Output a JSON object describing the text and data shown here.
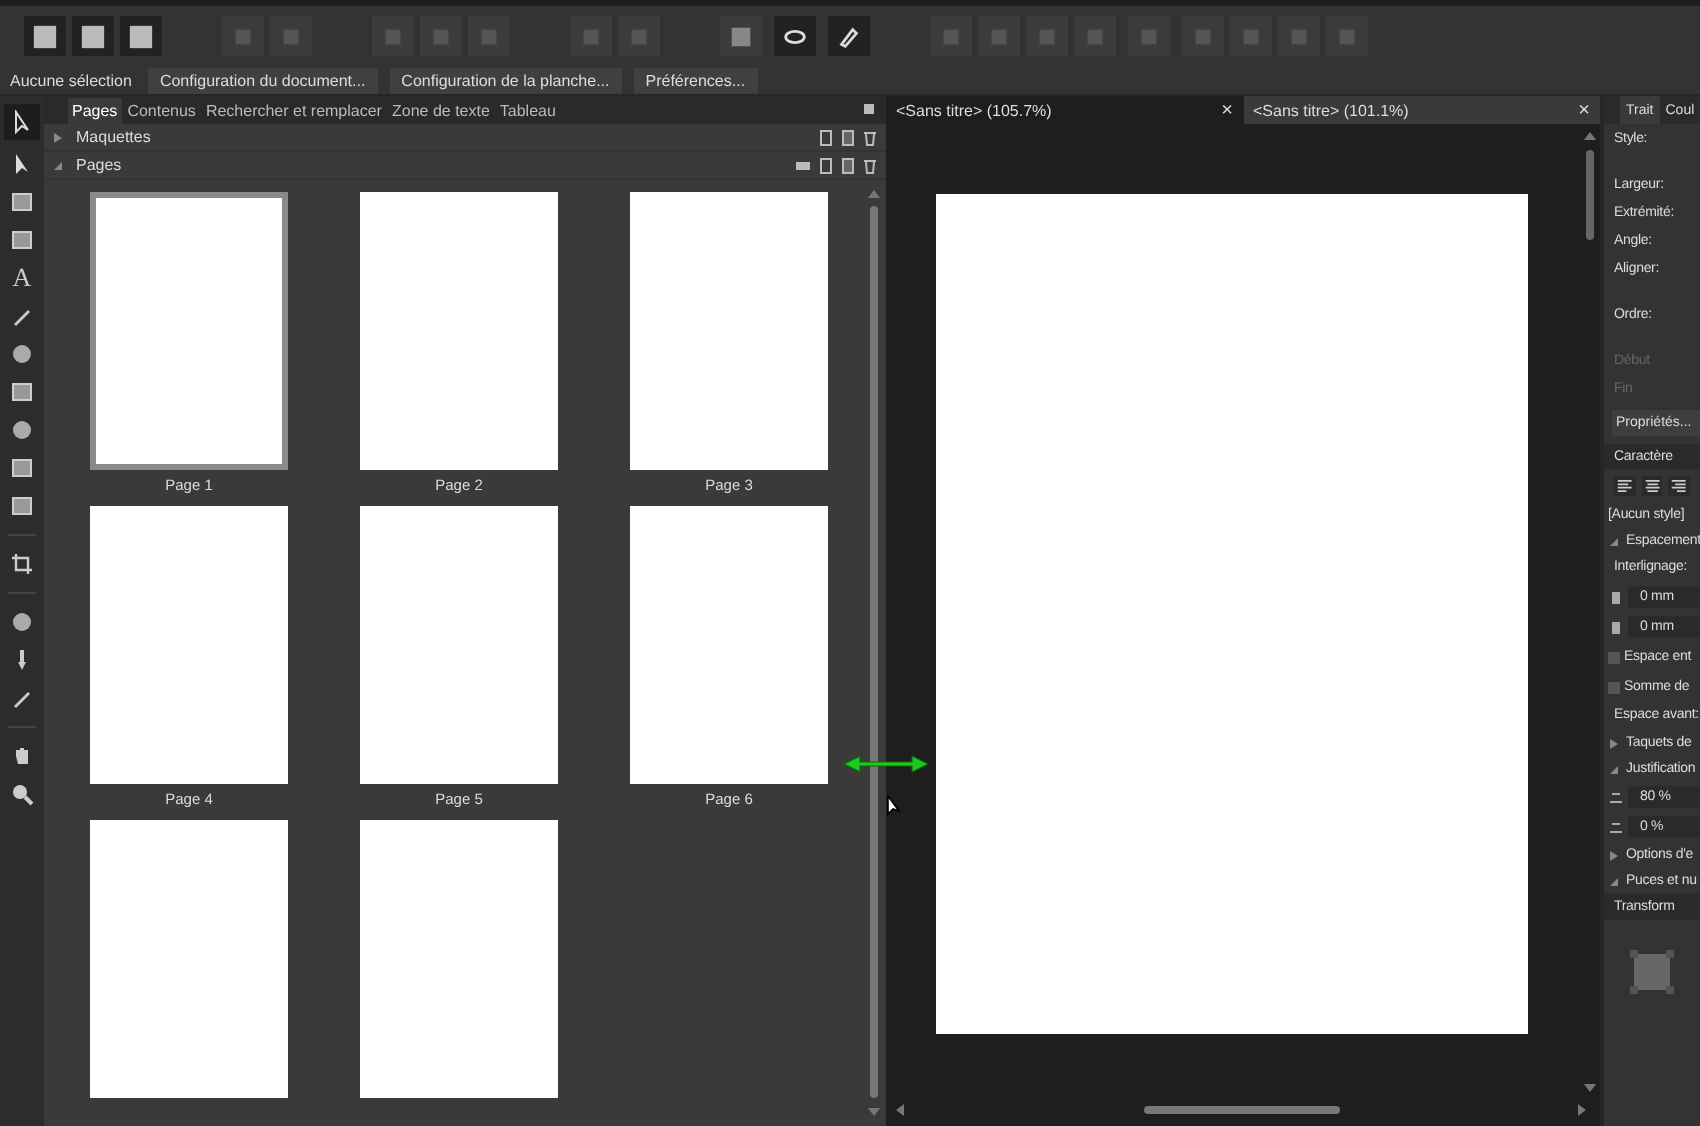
{
  "context_bar": {
    "status": "Aucune sélection",
    "buttons": [
      "Configuration du document...",
      "Configuration de la planche...",
      "Préférences..."
    ]
  },
  "text_tool_glyph": "A",
  "studio_tabs": [
    {
      "label": "Pages",
      "selected": true
    },
    {
      "label": "Contenus",
      "selected": false
    },
    {
      "label": "Rechercher et remplacer",
      "selected": false
    },
    {
      "label": "Zone de texte",
      "selected": false
    },
    {
      "label": "Tableau",
      "selected": false
    }
  ],
  "sections": [
    {
      "label": "Maquettes",
      "expanded": false
    },
    {
      "label": "Pages",
      "expanded": true
    }
  ],
  "pages": [
    {
      "label": "Page 1",
      "selected": true
    },
    {
      "label": "Page 2",
      "selected": false
    },
    {
      "label": "Page 3",
      "selected": false
    },
    {
      "label": "Page 4",
      "selected": false
    },
    {
      "label": "Page 5",
      "selected": false
    },
    {
      "label": "Page 6",
      "selected": false
    },
    {
      "selected": false
    },
    {
      "selected": false
    }
  ],
  "document_tabs": [
    {
      "title": "<Sans titre> (105.7%)",
      "selected": true
    },
    {
      "title": "<Sans titre> (101.1%)",
      "selected": false
    }
  ],
  "close_glyph": "×",
  "right_panel": {
    "tabs": [
      {
        "label": "Trait",
        "selected": true
      },
      {
        "label": "Coul",
        "selected": false
      }
    ],
    "stroke_rows": [
      {
        "label": "Style:",
        "disabled": false
      },
      {
        "label": "Largeur:",
        "disabled": false
      },
      {
        "label": "Extrémité:",
        "disabled": false
      },
      {
        "label": "Angle:",
        "disabled": false
      },
      {
        "label": "Aligner:",
        "disabled": false
      },
      {
        "label": "Ordre:",
        "disabled": false
      },
      {
        "label": "Début",
        "disabled": true
      },
      {
        "label": "Fin",
        "disabled": true
      }
    ],
    "properties_button": "Propriétés...",
    "character_title": "Caractère",
    "style_field": "[Aucun style]",
    "spacing_section": "Espacement",
    "leading_label": "Interlignage:",
    "spacing_fields": [
      "0 mm",
      "0 mm"
    ],
    "checkboxes": [
      {
        "label": "Espace ent",
        "checked": false
      },
      {
        "label": "Somme de",
        "checked": false
      }
    ],
    "space_before_label": "Espace avant:",
    "sections": [
      {
        "label": "Taquets de",
        "expanded": false
      },
      {
        "label": "Justification",
        "expanded": true
      }
    ],
    "percent_fields": [
      "80 %",
      "0 %"
    ],
    "more_sections": [
      {
        "label": "Options d'e",
        "expanded": false
      },
      {
        "label": "Puces et nu",
        "expanded": true
      }
    ],
    "transform_title": "Transform"
  }
}
